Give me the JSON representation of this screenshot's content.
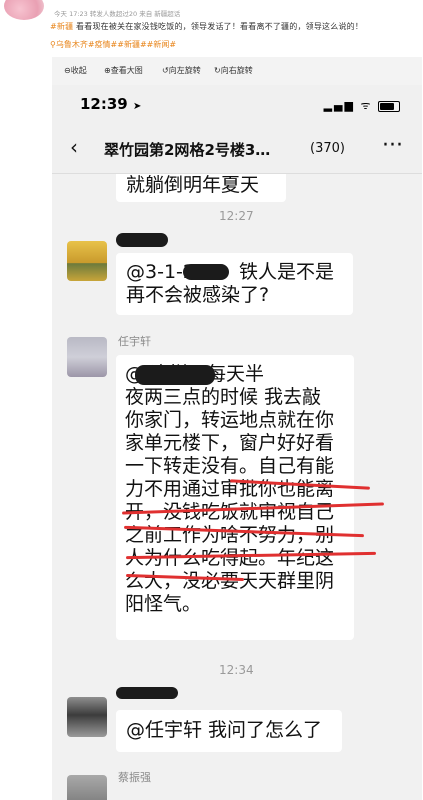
{
  "post": {
    "top_name": "",
    "meta": "今天 17:23 转发人数超过20  来自 新疆超话",
    "tag1": "#新疆",
    "body_text": "  看看现在被关在家没钱吃饭的，领导发话了！看看离不了疆的，领导这么说的！",
    "tags": "⚲乌鲁木齐#疫情##新疆##新闻#"
  },
  "toolbar": {
    "collapse": "⊖收起",
    "view_large": "⊕查看大图",
    "rotate_left": "↺向左旋转",
    "rotate_right": "↻向右旋转"
  },
  "phone": {
    "time": "12:39",
    "status_icons": "▂▄▆ ᯤ",
    "back": "‹",
    "chat_title": "翠竹园第2网格2号楼3…",
    "member_count": "(370)",
    "more": "···"
  },
  "messages": {
    "prev_fragment": "就躺倒明年夏天",
    "ts1": "12:27",
    "msg1_line1": "@3-1-2",
    "msg1_line1b": "铁人是不是",
    "msg1_line2": "再不会被感染了?",
    "sender2": "任宇轩",
    "msg2_lines": [
      "@             这样，每天半",
      "夜两三点的时候 我去敲",
      "你家门，转运地点就在你",
      "家单元楼下，窗户好好看",
      "一下转走没有。自己有能",
      "力不用通过审批你也能离",
      "开，没钱吃饭就审视自己",
      "之前工作为啥不努力，别",
      "人为什么吃得起。年纪这",
      "么大，没必要天天群里阴",
      "阳怪气。"
    ],
    "ts2": "12:34",
    "msg3": "@任宇轩 我问了怎么了",
    "sender4": "蔡振强"
  },
  "colors": {
    "accent_orange": "#e8851b",
    "annotation_red": "#e03030",
    "chat_bg": "#f1f1f1"
  }
}
